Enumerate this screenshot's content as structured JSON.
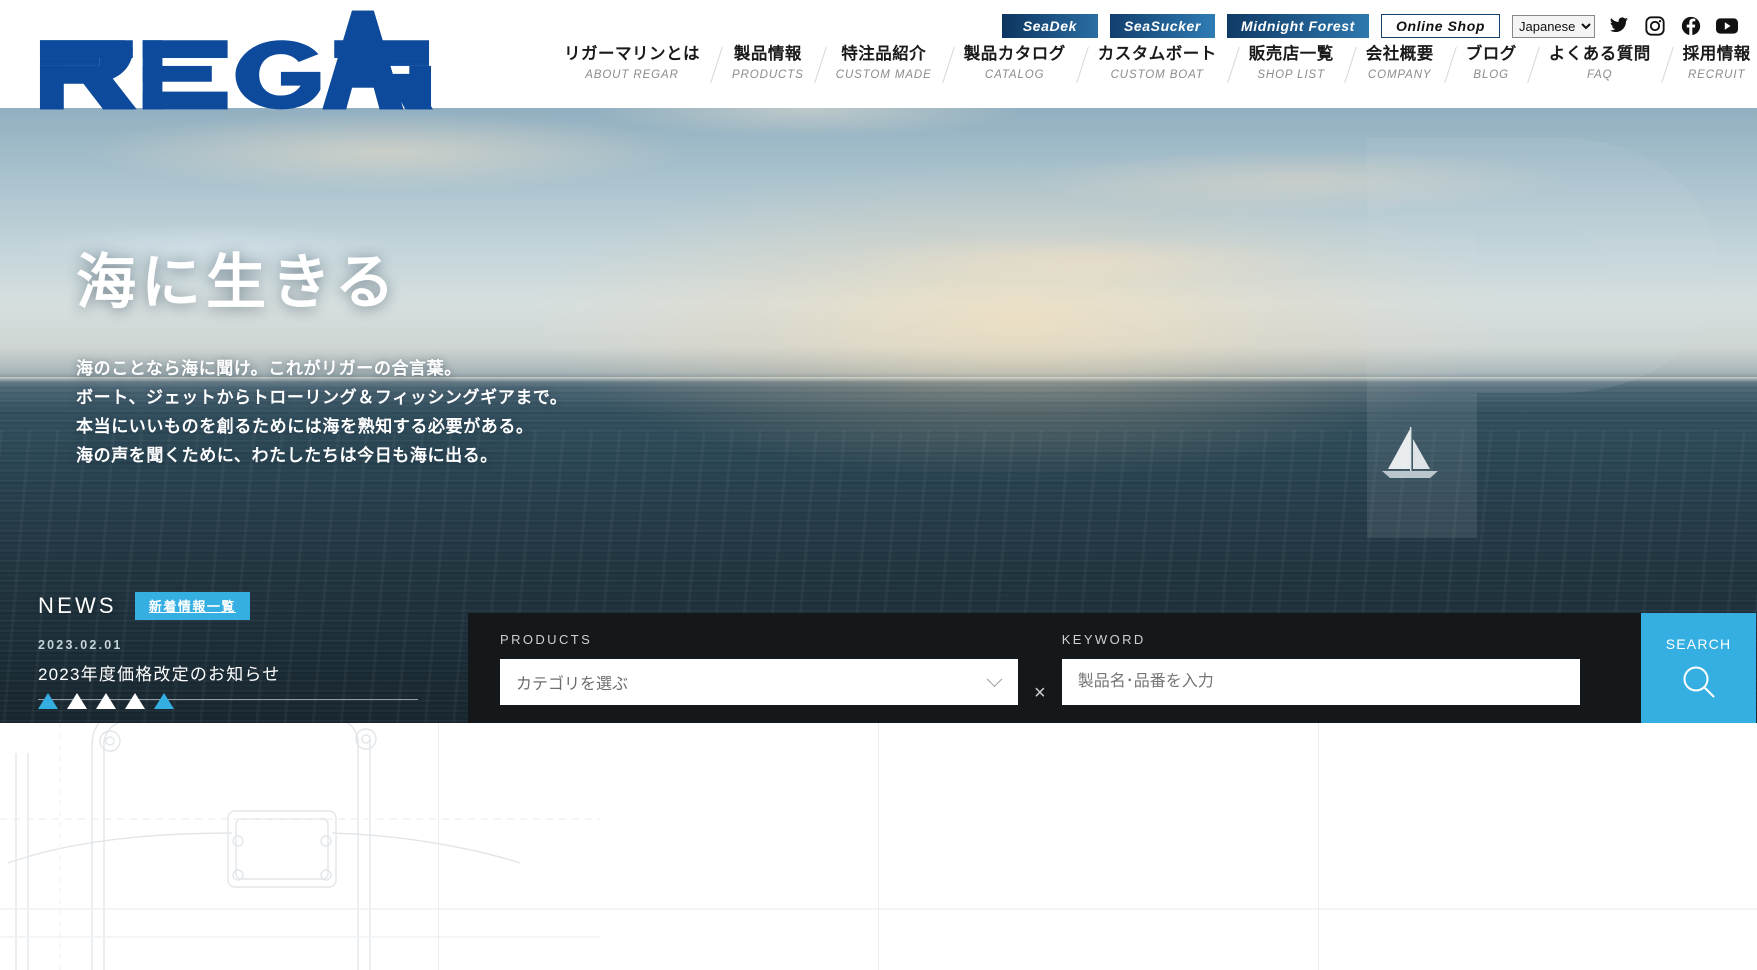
{
  "site": {
    "logo_text": "REGAR"
  },
  "utility": {
    "brand_buttons": [
      {
        "label": "SeaDek",
        "name": "seadek-button"
      },
      {
        "label": "SeaSucker",
        "name": "seasucker-button"
      },
      {
        "label": "Midnight Forest",
        "name": "midnight-forest-button"
      }
    ],
    "online_shop_label": "Online Shop",
    "language_selected": "Japanese",
    "language_options": [
      "Japanese"
    ],
    "social": [
      {
        "name": "twitter-icon",
        "label": "Twitter"
      },
      {
        "name": "instagram-icon",
        "label": "Instagram"
      },
      {
        "name": "facebook-icon",
        "label": "Facebook"
      },
      {
        "name": "youtube-icon",
        "label": "YouTube"
      }
    ]
  },
  "nav": {
    "items": [
      {
        "ja": "リガーマリンとは",
        "en": "ABOUT REGAR",
        "name": "nav-item-about"
      },
      {
        "ja": "製品情報",
        "en": "PRODUCTS",
        "name": "nav-item-products"
      },
      {
        "ja": "特注品紹介",
        "en": "CUSTOM MADE",
        "name": "nav-item-custom-made"
      },
      {
        "ja": "製品カタログ",
        "en": "CATALOG",
        "name": "nav-item-catalog"
      },
      {
        "ja": "カスタムボート",
        "en": "CUSTOM BOAT",
        "name": "nav-item-custom-boat"
      },
      {
        "ja": "販売店一覧",
        "en": "SHOP LIST",
        "name": "nav-item-shop-list"
      },
      {
        "ja": "会社概要",
        "en": "COMPANY",
        "name": "nav-item-company"
      },
      {
        "ja": "ブログ",
        "en": "BLOG",
        "name": "nav-item-blog"
      },
      {
        "ja": "よくある質問",
        "en": "FAQ",
        "name": "nav-item-faq"
      },
      {
        "ja": "採用情報",
        "en": "RECRUIT",
        "name": "nav-item-recruit"
      }
    ]
  },
  "hero": {
    "title": "海に生きる",
    "lines": [
      "海のことなら海に聞け。これがリガーの合言葉。",
      "ボート、ジェットからトローリング＆フィッシングギアまで。",
      "本当にいいものを創るためには海を熟知する必要がある。",
      "海の声を聞くために、わたしたちは今日も海に出る。"
    ]
  },
  "news": {
    "label": "NEWS",
    "list_button": "新着情報一覧",
    "date": "2023.02.01",
    "title": "2023年度価格改定のお知らせ"
  },
  "slider": {
    "slides": 5,
    "active_indices": [
      0,
      4
    ]
  },
  "search": {
    "products_label": "PRODUCTS",
    "products_placeholder": "カテゴリを選ぶ",
    "separator": "×",
    "keyword_label": "KEYWORD",
    "keyword_placeholder": "製品名･品番を入力",
    "button_label": "SEARCH"
  },
  "colors": {
    "brand_blue": "#0d4a9c",
    "accent_cyan": "#35aee2",
    "panel_dark": "#15181b",
    "nav_text": "#1a1a1a",
    "nav_sub": "#8b8b8b"
  }
}
